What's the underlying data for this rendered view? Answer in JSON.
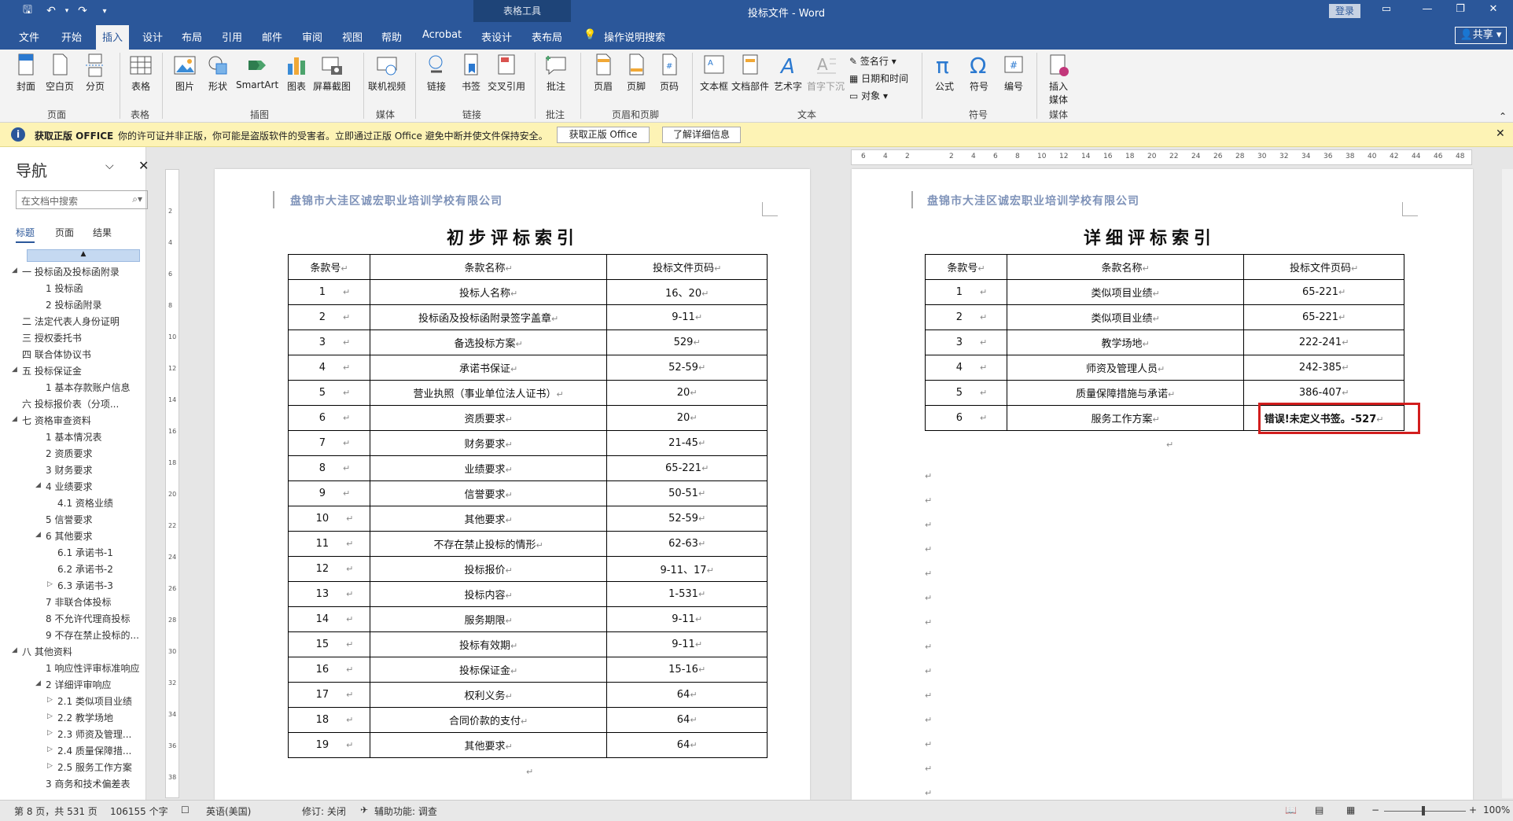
{
  "titlebar": {
    "doc_title": "投标文件 - Word",
    "context_tools": "表格工具",
    "login": "登录",
    "share": "共享"
  },
  "tabs": [
    {
      "label": "文件"
    },
    {
      "label": "开始"
    },
    {
      "label": "插入",
      "active": true
    },
    {
      "label": "设计"
    },
    {
      "label": "布局"
    },
    {
      "label": "引用"
    },
    {
      "label": "邮件"
    },
    {
      "label": "审阅"
    },
    {
      "label": "视图"
    },
    {
      "label": "帮助"
    },
    {
      "label": "Acrobat"
    },
    {
      "label": "表设计"
    },
    {
      "label": "表布局"
    },
    {
      "label": "操作说明搜索"
    }
  ],
  "ribbon": {
    "buttons": [
      "封面",
      "空白页",
      "分页",
      "表格",
      "图片",
      "形状",
      "SmartArt",
      "图表",
      "屏幕截图",
      "联机视频",
      "链接",
      "书签",
      "交叉引用",
      "批注",
      "页眉",
      "页脚",
      "页码",
      "文本框",
      "文档部件",
      "艺术字",
      "首字下沉",
      "公式",
      "符号",
      "编号",
      "插入媒体"
    ],
    "small": [
      "签名行",
      "日期和时间",
      "对象"
    ],
    "groups": [
      "页面",
      "表格",
      "插图",
      "媒体",
      "链接",
      "批注",
      "页眉和页脚",
      "文本",
      "符号",
      "媒体"
    ]
  },
  "message": {
    "title": "获取正版 OFFICE",
    "text": "你的许可证并非正版，你可能是盗版软件的受害者。立即通过正版 Office 避免中断并使文件保持安全。",
    "btn1": "获取正版 Office",
    "btn2": "了解详细信息"
  },
  "nav": {
    "title": "导航",
    "search_placeholder": "在文档中搜索",
    "tabs": [
      "标题",
      "页面",
      "结果"
    ],
    "items": [
      "一 投标函及投标函附录",
      "1 投标函",
      "2 投标函附录",
      "二 法定代表人身份证明",
      "三 授权委托书",
      "四 联合体协议书",
      "五 投标保证金",
      "1 基本存款账户信息",
      "六 投标报价表（分项...",
      "七 资格审查资料",
      "1 基本情况表",
      "2 资质要求",
      "3 财务要求",
      "4 业绩要求",
      "4.1 资格业绩",
      "5 信誉要求",
      "6 其他要求",
      "6.1 承诺书-1",
      "6.2 承诺书-2",
      "6.3 承诺书-3",
      "7 非联合体投标",
      "8 不允许代理商投标",
      "9 不存在禁止投标的...",
      "八 其他资料",
      "1 响应性评审标准响应",
      "2 详细评审响应",
      "2.1 类似项目业绩",
      "2.2 教学场地",
      "2.3 师资及管理...",
      "2.4 质量保障措...",
      "2.5 服务工作方案",
      "3 商务和技术偏差表"
    ]
  },
  "page1": {
    "header": "盘锦市大洼区诚宏职业培训学校有限公司",
    "title": "初步评标索引",
    "columns": [
      "条款号",
      "条款名称",
      "投标文件页码"
    ],
    "rows": [
      [
        "1",
        "投标人名称",
        "16、20"
      ],
      [
        "2",
        "投标函及投标函附录签字盖章",
        "9-11"
      ],
      [
        "3",
        "备选投标方案",
        "529"
      ],
      [
        "4",
        "承诺书保证",
        "52-59"
      ],
      [
        "5",
        "营业执照（事业单位法人证书）",
        "20"
      ],
      [
        "6",
        "资质要求",
        "20"
      ],
      [
        "7",
        "财务要求",
        "21-45"
      ],
      [
        "8",
        "业绩要求",
        "65-221"
      ],
      [
        "9",
        "信誉要求",
        "50-51"
      ],
      [
        "10",
        "其他要求",
        "52-59"
      ],
      [
        "11",
        "不存在禁止投标的情形",
        "62-63"
      ],
      [
        "12",
        "投标报价",
        "9-11、17"
      ],
      [
        "13",
        "投标内容",
        "1-531"
      ],
      [
        "14",
        "服务期限",
        "9-11"
      ],
      [
        "15",
        "投标有效期",
        "9-11"
      ],
      [
        "16",
        "投标保证金",
        "15-16"
      ],
      [
        "17",
        "权利义务",
        "64"
      ],
      [
        "18",
        "合同价款的支付",
        "64"
      ],
      [
        "19",
        "其他要求",
        "64"
      ]
    ]
  },
  "page2": {
    "header": "盘锦市大洼区诚宏职业培训学校有限公司",
    "title": "详细评标索引",
    "columns": [
      "条款号",
      "条款名称",
      "投标文件页码"
    ],
    "rows": [
      [
        "1",
        "类似项目业绩",
        "65-221"
      ],
      [
        "2",
        "类似项目业绩",
        "65-221"
      ],
      [
        "3",
        "教学场地",
        "222-241"
      ],
      [
        "4",
        "师资及管理人员",
        "242-385"
      ],
      [
        "5",
        "质量保障措施与承诺",
        "386-407"
      ],
      [
        "6",
        "服务工作方案",
        "错误!未定义书签。-527"
      ]
    ]
  },
  "status": {
    "page": "第 8 页，共 531 页",
    "words": "106155 个字",
    "lang": "英语(美国)",
    "track": "修订: 关闭",
    "access": "辅助功能: 调查",
    "zoom": "100%"
  }
}
